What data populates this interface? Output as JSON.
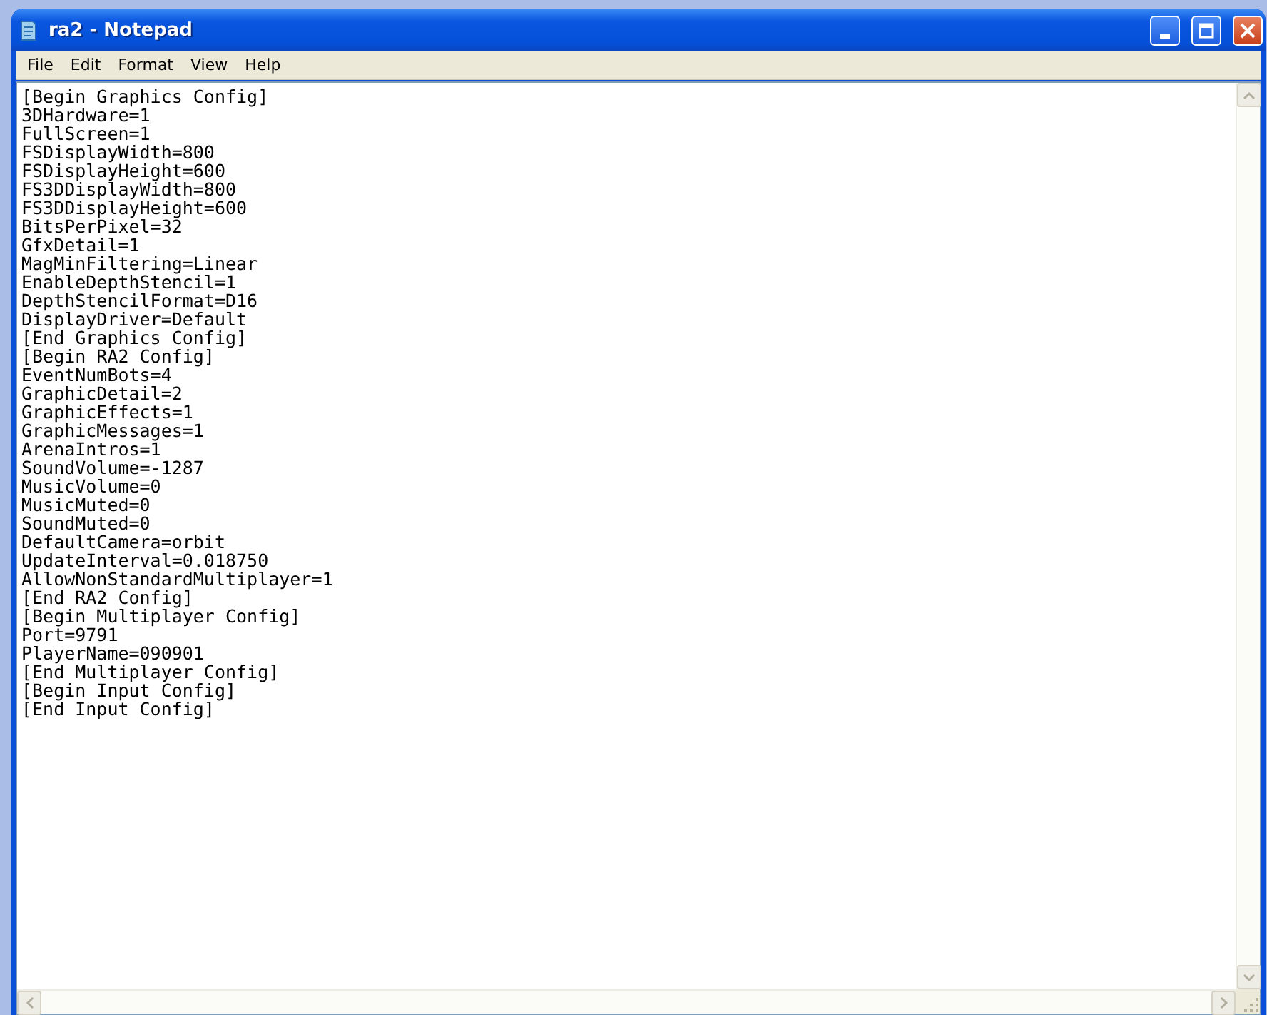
{
  "window": {
    "title": "ra2 - Notepad"
  },
  "menu": [
    "File",
    "Edit",
    "Format",
    "View",
    "Help"
  ],
  "lines": [
    "[Begin Graphics Config]",
    "3DHardware=1",
    "FullScreen=1",
    "FSDisplayWidth=800",
    "FSDisplayHeight=600",
    "FS3DDisplayWidth=800",
    "FS3DDisplayHeight=600",
    "BitsPerPixel=32",
    "GfxDetail=1",
    "MagMinFiltering=Linear",
    "EnableDepthStencil=1",
    "DepthStencilFormat=D16",
    "DisplayDriver=Default",
    "[End Graphics Config]",
    "[Begin RA2 Config]",
    "EventNumBots=4",
    "GraphicDetail=2",
    "GraphicEffects=1",
    "GraphicMessages=1",
    "ArenaIntros=1",
    "SoundVolume=-1287",
    "MusicVolume=0",
    "MusicMuted=0",
    "SoundMuted=0",
    "DefaultCamera=orbit",
    "UpdateInterval=0.018750",
    "AllowNonStandardMultiplayer=1",
    "[End RA2 Config]",
    "[Begin Multiplayer Config]",
    "Port=9791",
    "PlayerName=090901",
    "[End Multiplayer Config]",
    "[Begin Input Config]",
    "[End Input Config]"
  ]
}
